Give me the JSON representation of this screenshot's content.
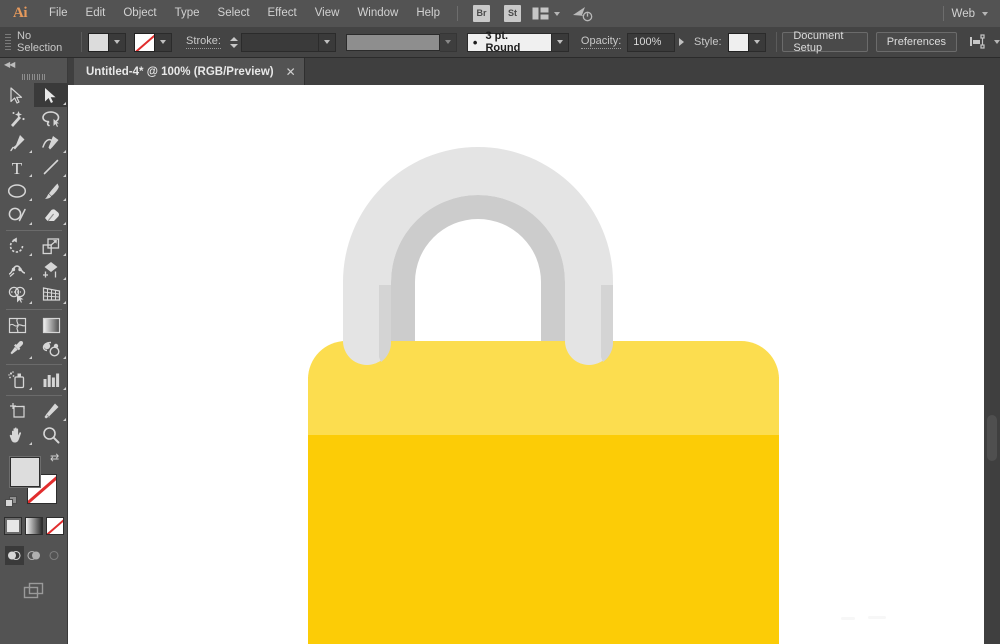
{
  "app": {
    "name": "Ai",
    "workspace_label": "Web"
  },
  "menubar": {
    "items": [
      {
        "label": "File"
      },
      {
        "label": "Edit"
      },
      {
        "label": "Object"
      },
      {
        "label": "Type"
      },
      {
        "label": "Select"
      },
      {
        "label": "Effect"
      },
      {
        "label": "View"
      },
      {
        "label": "Window"
      },
      {
        "label": "Help"
      }
    ],
    "bridge_label": "Br",
    "stock_label": "St",
    "arrange_icon": "arrange-documents-icon",
    "sync_icon": "sync-settings-icon"
  },
  "controlbar": {
    "selection_status": "No Selection",
    "fill_label": "fill-swatch",
    "stroke_swatch_label": "stroke-swatch-none",
    "stroke_label": "Stroke:",
    "stroke_weight_value": "",
    "variable_width_value": "3 pt. Round",
    "opacity_label": "Opacity:",
    "opacity_value": "100%",
    "style_label": "Style:",
    "document_setup_label": "Document Setup",
    "preferences_label": "Preferences",
    "align_icon": "align-to-pixel-grid-icon"
  },
  "tabs": [
    {
      "title": "Untitled-4* @ 100% (RGB/Preview)",
      "close_label": "✕",
      "active": true
    }
  ],
  "toolbar": {
    "collapse_label": "◀◀",
    "groups": [
      {
        "tools": [
          {
            "name": "selection-tool",
            "selected": false,
            "has_flyout": false
          },
          {
            "name": "direct-selection-tool",
            "selected": true,
            "has_flyout": true
          },
          {
            "name": "magic-wand-tool",
            "selected": false,
            "has_flyout": false
          },
          {
            "name": "lasso-tool",
            "selected": false,
            "has_flyout": false
          },
          {
            "name": "pen-tool",
            "selected": false,
            "has_flyout": true
          },
          {
            "name": "curvature-tool",
            "selected": false,
            "has_flyout": true
          },
          {
            "name": "type-tool",
            "selected": false,
            "has_flyout": true
          },
          {
            "name": "line-segment-tool",
            "selected": false,
            "has_flyout": true
          },
          {
            "name": "ellipse-tool",
            "selected": false,
            "has_flyout": true
          },
          {
            "name": "paintbrush-tool",
            "selected": false,
            "has_flyout": true
          },
          {
            "name": "shaper-tool",
            "selected": false,
            "has_flyout": true
          },
          {
            "name": "eraser-tool",
            "selected": false,
            "has_flyout": true
          }
        ]
      },
      {
        "tools": [
          {
            "name": "rotate-tool",
            "selected": false,
            "has_flyout": true
          },
          {
            "name": "scale-tool",
            "selected": false,
            "has_flyout": true
          },
          {
            "name": "width-tool",
            "selected": false,
            "has_flyout": true
          },
          {
            "name": "free-transform-tool",
            "selected": false,
            "has_flyout": true
          },
          {
            "name": "shape-builder-tool",
            "selected": false,
            "has_flyout": true
          },
          {
            "name": "perspective-grid-tool",
            "selected": false,
            "has_flyout": true
          }
        ]
      },
      {
        "tools": [
          {
            "name": "mesh-tool",
            "selected": false,
            "has_flyout": false
          },
          {
            "name": "gradient-tool",
            "selected": false,
            "has_flyout": false
          },
          {
            "name": "eyedropper-tool",
            "selected": false,
            "has_flyout": true
          },
          {
            "name": "blend-tool",
            "selected": false,
            "has_flyout": true
          }
        ]
      },
      {
        "tools": [
          {
            "name": "symbol-sprayer-tool",
            "selected": false,
            "has_flyout": true
          },
          {
            "name": "column-graph-tool",
            "selected": false,
            "has_flyout": true
          }
        ]
      },
      {
        "tools": [
          {
            "name": "artboard-tool",
            "selected": false,
            "has_flyout": false
          },
          {
            "name": "slice-tool",
            "selected": false,
            "has_flyout": true
          },
          {
            "name": "hand-tool",
            "selected": false,
            "has_flyout": true
          },
          {
            "name": "zoom-tool",
            "selected": false,
            "has_flyout": false
          }
        ]
      }
    ],
    "fill_color": "#dddddd",
    "stroke_color": "none",
    "swap_label": "⇄",
    "paint_modes": [
      {
        "name": "color-mode",
        "active": true
      },
      {
        "name": "gradient-mode",
        "active": false
      },
      {
        "name": "none-mode",
        "active": false
      }
    ],
    "draw_modes": [
      {
        "name": "draw-normal",
        "active": true
      },
      {
        "name": "draw-behind",
        "active": false
      },
      {
        "name": "draw-inside",
        "active": false
      }
    ],
    "screen_mode": "change-screen-mode-icon"
  },
  "artwork": {
    "name": "padlock-illustration",
    "colors": {
      "body_light": "#fcdd4f",
      "body_main": "#fccc06",
      "shackle_light": "#e4e4e4",
      "shackle_mid": "#dcdcdc",
      "shackle_shadow": "#cccccc",
      "canvas": "#ffffff"
    }
  }
}
